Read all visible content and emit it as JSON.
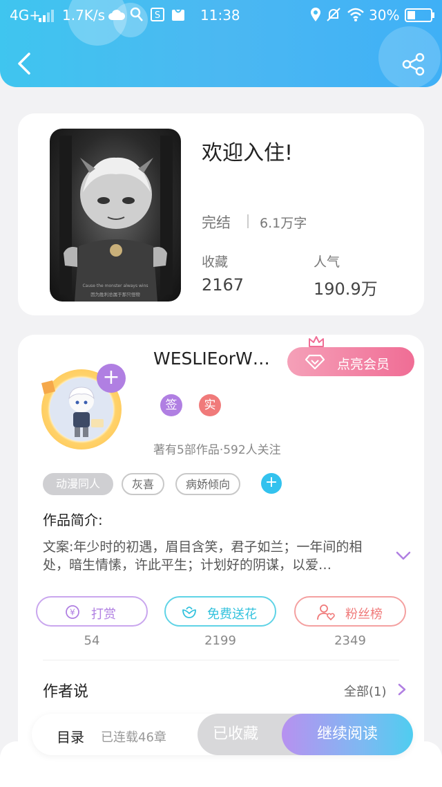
{
  "status_bar": {
    "network": "4G+",
    "speed": "1.7K/s",
    "time": "11:38",
    "battery": "30%"
  },
  "book": {
    "title": "欢迎入住!",
    "status": "完结",
    "word_count": "6.1万字",
    "collect_label": "收藏",
    "collect_value": "2167",
    "popularity_label": "人气",
    "popularity_value": "190.9万",
    "cover_caption_en": "Cause the monster always wins",
    "cover_caption_cn": "因为胜利总属于那只怪物"
  },
  "author": {
    "name": "WESLIEorW…",
    "vip_label": "点亮会员",
    "badges": [
      "签",
      "实"
    ],
    "meta": "著有5部作品·592人关注"
  },
  "tags": [
    "动漫同人",
    "灰喜",
    "病娇倾向"
  ],
  "intro": {
    "heading": "作品简介:",
    "text": "文案:年少时的初遇，眉目含笑，君子如兰；一年间的相处，暗生情愫，许此平生；计划好的阴谋，以爱…"
  },
  "actions": [
    {
      "label": "打赏",
      "count": "54"
    },
    {
      "label": "免费送花",
      "count": "2199"
    },
    {
      "label": "粉丝榜",
      "count": "2349"
    }
  ],
  "author_says": {
    "heading": "作者说",
    "all_label": "全部(1)"
  },
  "bottom_bar": {
    "toc_label": "目录",
    "chapters": "已连载46章",
    "collected_label": "已收藏",
    "continue_label": "继续阅读"
  },
  "colors": {
    "header": "#45bdf2",
    "vip": "#f06d95",
    "reward": "#b07fe2",
    "flower": "#33c2dd",
    "fans": "#f07a7a",
    "accent_purple": "#b07fe2"
  }
}
